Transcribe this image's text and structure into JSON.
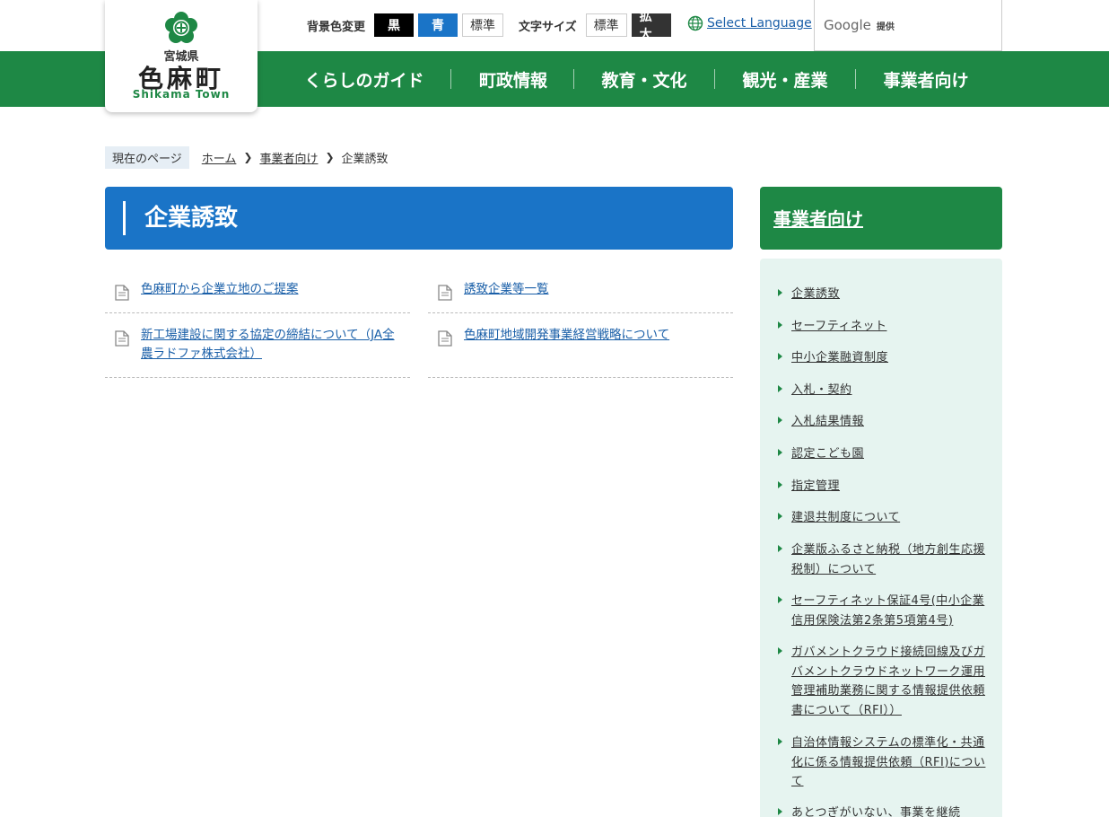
{
  "header": {
    "bg_label": "背景色変更",
    "bg_black": "黒",
    "bg_blue": "青",
    "bg_standard": "標準",
    "fontsize_label": "文字サイズ",
    "fontsize_standard": "標準",
    "fontsize_large": "拡大",
    "language": "Select Language",
    "google": "Google",
    "google_provided": "提供"
  },
  "logo": {
    "prefecture": "宮城県",
    "town": "色麻町",
    "town_en": "Shikama Town"
  },
  "nav": [
    "くらしのガイド",
    "町政情報",
    "教育・文化",
    "観光・産業",
    "事業者向け"
  ],
  "breadcrumb": {
    "label": "現在のページ",
    "items": [
      "ホーム",
      "事業者向け",
      "企業誘致"
    ]
  },
  "page_title": "企業誘致",
  "links": [
    "色麻町から企業立地のご提案",
    "誘致企業等一覧",
    "新工場建設に関する協定の締結について（JA全農ラドファ株式会社）",
    "色麻町地域開発事業経営戦略について"
  ],
  "sidebar": {
    "heading": "事業者向け",
    "items": [
      "企業誘致",
      "セーフティネット",
      "中小企業融資制度",
      "入札・契約",
      "入札結果情報",
      "認定こども園",
      "指定管理",
      "建退共制度について",
      "企業版ふるさと納税（地方創生応援税制）について",
      "セーフティネット保証4号(中小企業信用保険法第2条第5項第4号)",
      "ガバメントクラウド接続回線及びガバメントクラウドネットワーク運用管理補助業務に関する情報提供依頼書について（RFI））",
      "自治体情報システムの標準化・共通化に係る情報提供依頼（RFI)について",
      "あとつぎがいない、事業を継続"
    ]
  },
  "colors": {
    "green": "#1e8845",
    "blue": "#1a74c7",
    "sidebar_bg": "#e6f4f0"
  }
}
